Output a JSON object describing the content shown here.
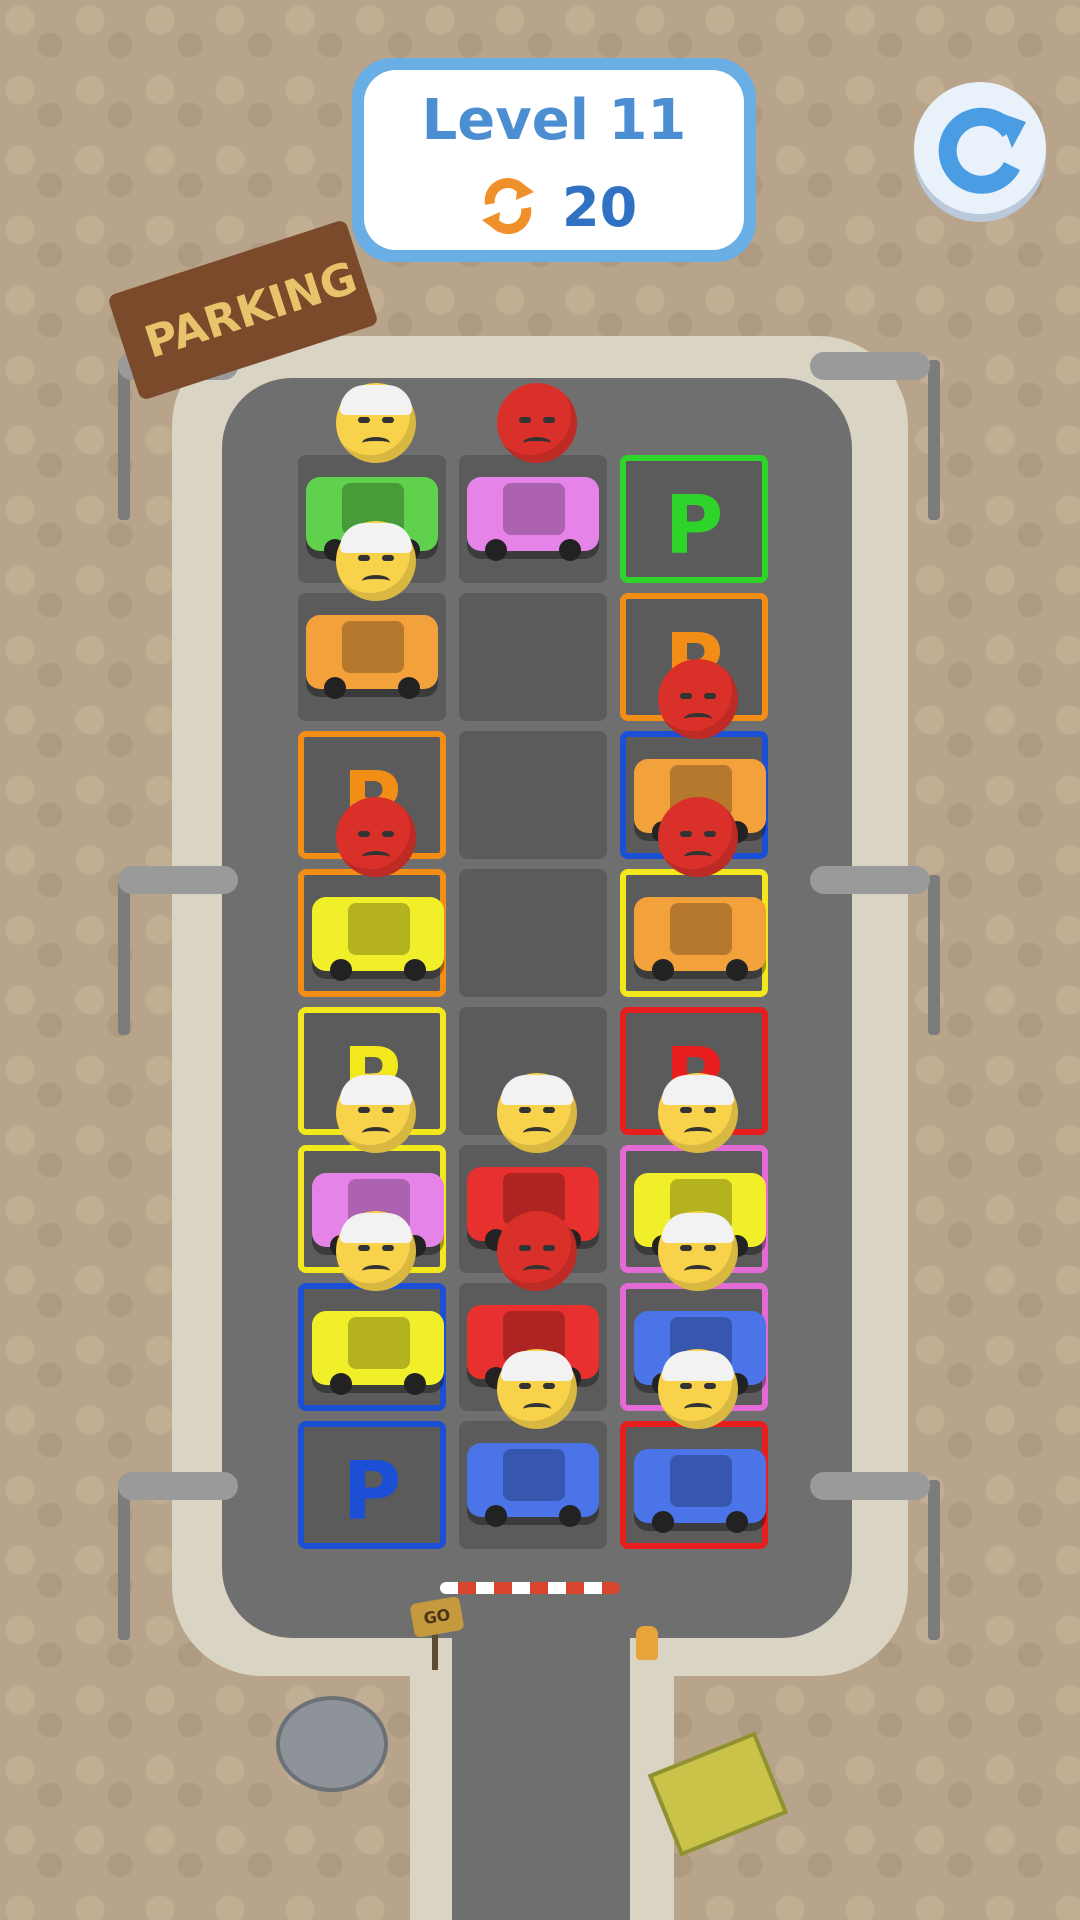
{
  "hud": {
    "level_label": "Level 11",
    "moves_count": "20",
    "moves_icon": "swap-arrows-icon",
    "restart_icon": "restart-icon"
  },
  "sign": {
    "text": "PARKING"
  },
  "road": {
    "go_label": "GO"
  },
  "colors": {
    "green": "#2fd42a",
    "orange": "#f28e16",
    "blue": "#1b4fd6",
    "yellow": "#f2e81b",
    "red": "#e81d1d",
    "pink": "#e46ad6",
    "car_green": "#5fd14c",
    "car_pink": "#e683e8",
    "car_orange": "#f2a13b",
    "car_yellow": "#f1ef2a",
    "car_red": "#e8312f",
    "car_blue": "#4a74e8"
  },
  "slots": [
    {
      "id": "c0r0",
      "ring": null,
      "p": null,
      "car": "car_green",
      "mood": "hurt"
    },
    {
      "id": "c1r0",
      "ring": null,
      "p": null,
      "car": "car_pink",
      "mood": "angry"
    },
    {
      "id": "c2r0",
      "ring": "green",
      "p": "P",
      "car": null,
      "mood": null
    },
    {
      "id": "c0r1",
      "ring": null,
      "p": null,
      "car": "car_orange",
      "mood": "hurt"
    },
    {
      "id": "c1r1",
      "ring": null,
      "p": null,
      "car": null,
      "mood": null
    },
    {
      "id": "c2r1",
      "ring": "orange",
      "p": "P",
      "car": null,
      "mood": null
    },
    {
      "id": "c0r2",
      "ring": "orange",
      "p": "P",
      "car": null,
      "mood": null
    },
    {
      "id": "c1r2",
      "ring": null,
      "p": null,
      "car": null,
      "mood": null
    },
    {
      "id": "c2r2",
      "ring": "blue",
      "p": null,
      "car": "car_orange",
      "mood": "angry"
    },
    {
      "id": "c0r3",
      "ring": "orange",
      "p": null,
      "car": "car_yellow",
      "mood": "angry"
    },
    {
      "id": "c1r3",
      "ring": null,
      "p": null,
      "car": null,
      "mood": null
    },
    {
      "id": "c2r3",
      "ring": "yellow",
      "p": null,
      "car": "car_orange",
      "mood": "angry"
    },
    {
      "id": "c0r4",
      "ring": "yellow",
      "p": "P",
      "car": null,
      "mood": null
    },
    {
      "id": "c1r4",
      "ring": null,
      "p": null,
      "car": null,
      "mood": null
    },
    {
      "id": "c2r4",
      "ring": "red",
      "p": "P",
      "car": null,
      "mood": null
    },
    {
      "id": "c0r5",
      "ring": "yellow",
      "p": null,
      "car": "car_pink",
      "mood": "hurt"
    },
    {
      "id": "c1r5",
      "ring": null,
      "p": null,
      "car": "car_red",
      "mood": "hurt"
    },
    {
      "id": "c2r5",
      "ring": "pink",
      "p": null,
      "car": "car_yellow",
      "mood": "hurt"
    },
    {
      "id": "c0r6",
      "ring": "blue",
      "p": null,
      "car": "car_yellow",
      "mood": "hurt"
    },
    {
      "id": "c1r6",
      "ring": null,
      "p": null,
      "car": "car_red",
      "mood": "angry"
    },
    {
      "id": "c2r6",
      "ring": "pink",
      "p": null,
      "car": "car_blue",
      "mood": "hurt"
    },
    {
      "id": "c0r7",
      "ring": "blue",
      "p": "P",
      "car": null,
      "mood": null
    },
    {
      "id": "c1r7",
      "ring": null,
      "p": null,
      "car": "car_blue",
      "mood": "hurt"
    },
    {
      "id": "c2r7",
      "ring": "red",
      "p": null,
      "car": "car_blue",
      "mood": "hurt"
    }
  ]
}
